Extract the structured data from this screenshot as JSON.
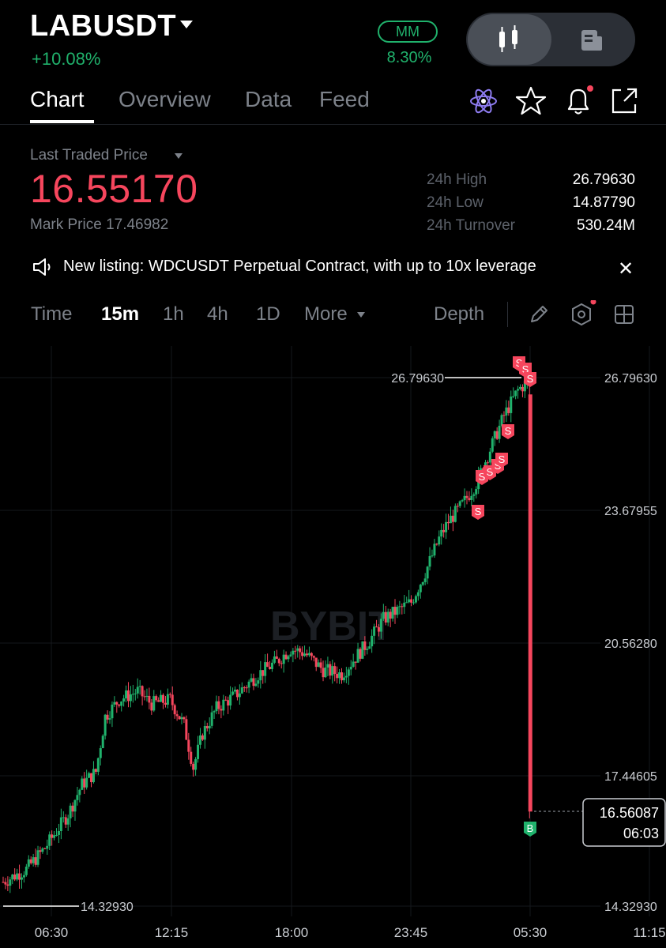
{
  "header": {
    "symbol": "LABUSDT",
    "change_pct": "+10.08%",
    "mm_badge": "MM",
    "mm_value": "8.30%"
  },
  "tabs": [
    {
      "label": "Chart",
      "active": true
    },
    {
      "label": "Overview",
      "active": false
    },
    {
      "label": "Data",
      "active": false
    },
    {
      "label": "Feed",
      "active": false
    }
  ],
  "header_icons": [
    "atom-icon",
    "star-icon",
    "bell-icon",
    "share-icon"
  ],
  "price": {
    "ltp_label": "Last Traded Price",
    "last_price": "16.55170",
    "mark_price": "Mark Price 17.46982",
    "stats": [
      {
        "label": "24h High",
        "value": "26.79630"
      },
      {
        "label": "24h Low",
        "value": "14.87790"
      },
      {
        "label": "24h Turnover",
        "value": "530.24M"
      }
    ]
  },
  "announcement": {
    "text": "New listing: WDCUSDT Perpetual Contract, with up to 10x leverage"
  },
  "intervals": {
    "items": [
      "Time",
      "15m",
      "1h",
      "4h",
      "1D",
      "More"
    ],
    "selected": "15m",
    "depth_label": "Depth"
  },
  "colors": {
    "up": "#20b26c",
    "down": "#f6465d",
    "background": "#000000",
    "muted": "#7d828a"
  },
  "chart_data": {
    "type": "candlestick",
    "watermark": "BYBIT",
    "y_ticks": [
      "26.79630",
      "23.67955",
      "20.56280",
      "17.44605",
      "14.32930"
    ],
    "x_ticks": [
      "06:30",
      "12:15",
      "18:00",
      "23:45",
      "05:30",
      "11:15"
    ],
    "ylim": [
      14.3293,
      26.7963
    ],
    "high_label": "26.79630",
    "low_label": "14.32930",
    "current_price_label": "16.56087",
    "current_time_label": "06:03",
    "trade_markers": {
      "sell": "S",
      "buy": "B"
    },
    "candles": []
  }
}
